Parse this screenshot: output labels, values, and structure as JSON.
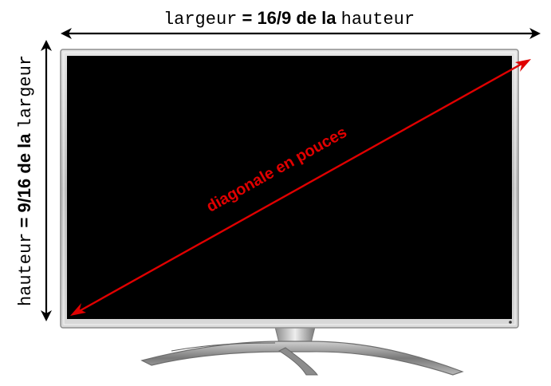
{
  "labels": {
    "width": {
      "var": "largeur",
      "eq": " = ",
      "frac": "16/9",
      "rest": " de la ",
      "ref": "hauteur"
    },
    "height": {
      "var": "hauteur",
      "eq": " = ",
      "frac": "9/16",
      "rest": " de la ",
      "ref": "largeur"
    },
    "diagonal": "diagonale en pouces"
  },
  "colors": {
    "screen": "#000000",
    "bezel": "#c8c8c8",
    "diagonal_arrow": "#e00000",
    "dimension_arrow": "#000000",
    "stand": "#9a9a9a"
  }
}
